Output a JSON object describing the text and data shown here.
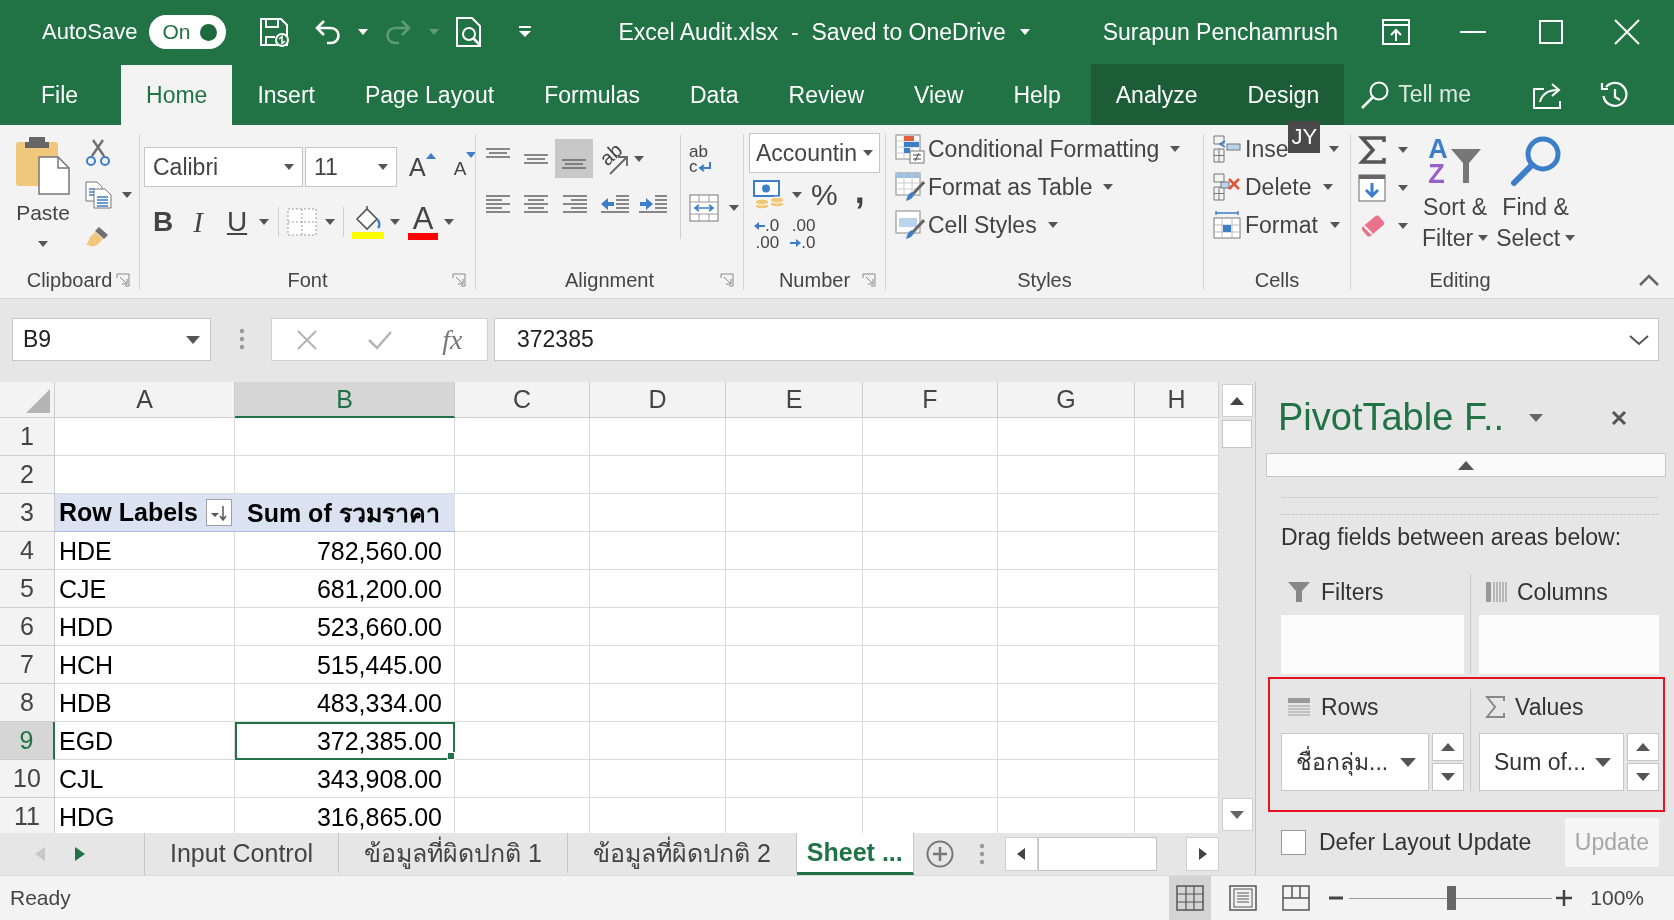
{
  "title_bar": {
    "autosave": {
      "label": "AutoSave",
      "toggle_text": "On",
      "on": true
    },
    "quick_access": [
      {
        "kind": "save",
        "disabled": false
      },
      {
        "kind": "undo",
        "disabled": false
      },
      {
        "kind": "redo",
        "disabled": true
      },
      {
        "kind": "preview",
        "disabled": false
      },
      {
        "kind": "customize",
        "disabled": false
      }
    ],
    "document_title": "Excel Audit.xlsx  -  Saved to OneDrive",
    "user_name": "Surapun Penchamrush"
  },
  "ribbon_tabs": {
    "tabs": [
      {
        "label": "File",
        "selected": false,
        "contextual": false
      },
      {
        "label": "Home",
        "selected": true,
        "contextual": false
      },
      {
        "label": "Insert",
        "selected": false,
        "contextual": false
      },
      {
        "label": "Page Layout",
        "selected": false,
        "contextual": false
      },
      {
        "label": "Formulas",
        "selected": false,
        "contextual": false
      },
      {
        "label": "Data",
        "selected": false,
        "contextual": false
      },
      {
        "label": "Review",
        "selected": false,
        "contextual": false
      },
      {
        "label": "View",
        "selected": false,
        "contextual": false
      },
      {
        "label": "Help",
        "selected": false,
        "contextual": false
      },
      {
        "label": "Analyze",
        "selected": false,
        "contextual": true
      },
      {
        "label": "Design",
        "selected": false,
        "contextual": true
      }
    ],
    "tell_me": {
      "placeholder": "Tell me"
    }
  },
  "ribbon": {
    "clipboard": {
      "label": "Clipboard",
      "paste": "Paste"
    },
    "font": {
      "label": "Font",
      "font_name": "Calibri",
      "font_size": "11",
      "grow_font": "A",
      "shrink_font": "A",
      "bold": "B",
      "italic": "I",
      "underline": "U",
      "font_color": "A"
    },
    "alignment": {
      "label": "Alignment",
      "vertical": [
        {
          "kind": "top",
          "selected": false
        },
        {
          "kind": "middle",
          "selected": false
        },
        {
          "kind": "bottom",
          "selected": true
        }
      ],
      "orientation": "ab",
      "wrap_text": [
        "ab",
        "c"
      ]
    },
    "number": {
      "label": "Number",
      "format": "Accountin",
      "percent": "%",
      "comma": ",",
      "increase_decimal": [
        ".0",
        ".00"
      ],
      "decrease_decimal": [
        ".00",
        ".0"
      ]
    },
    "styles": {
      "label": "Styles",
      "commands": [
        "Conditional Formatting",
        "Format as Table",
        "Cell Styles"
      ]
    },
    "cells": {
      "label": "Cells",
      "commands": [
        "Inse",
        "Delete",
        "Format"
      ],
      "keytip": "JY"
    },
    "editing": {
      "label": "Editing",
      "sort_letters": [
        "A",
        "Z"
      ],
      "sort_filter": [
        "Sort &",
        "Filter"
      ],
      "find_select": [
        "Find &",
        "Select"
      ]
    }
  },
  "formula_bar": {
    "name_box": "B9",
    "insert_function": "fx",
    "formula": "372385"
  },
  "sheet": {
    "columns": [
      {
        "label": "A",
        "selected": false
      },
      {
        "label": "B",
        "selected": true
      },
      {
        "label": "C",
        "selected": false
      },
      {
        "label": "D",
        "selected": false
      },
      {
        "label": "E",
        "selected": false
      },
      {
        "label": "F",
        "selected": false
      },
      {
        "label": "G",
        "selected": false
      },
      {
        "label": "H",
        "selected": false
      }
    ],
    "rows": [
      {
        "header": "1",
        "selected": false,
        "kind": "empty"
      },
      {
        "header": "2",
        "selected": false,
        "kind": "empty"
      },
      {
        "header": "3",
        "selected": false,
        "kind": "pivot_header",
        "cells": [
          "Row Labels",
          "Sum of รวมราคา"
        ]
      },
      {
        "header": "4",
        "selected": false,
        "kind": "data",
        "cells": [
          "HDE",
          "782,560.00"
        ]
      },
      {
        "header": "5",
        "selected": false,
        "kind": "data",
        "cells": [
          "CJE",
          "681,200.00"
        ]
      },
      {
        "header": "6",
        "selected": false,
        "kind": "data",
        "cells": [
          "HDD",
          "523,660.00"
        ]
      },
      {
        "header": "7",
        "selected": false,
        "kind": "data",
        "cells": [
          "HCH",
          "515,445.00"
        ]
      },
      {
        "header": "8",
        "selected": false,
        "kind": "data",
        "cells": [
          "HDB",
          "483,334.00"
        ]
      },
      {
        "header": "9",
        "selected": true,
        "kind": "data",
        "cells": [
          "EGD",
          "372,385.00"
        ]
      },
      {
        "header": "10",
        "selected": false,
        "kind": "data",
        "cells": [
          "CJL",
          "343,908.00"
        ]
      },
      {
        "header": "11",
        "selected": false,
        "kind": "data",
        "cells": [
          "HDG",
          "316,865.00"
        ]
      }
    ]
  },
  "sheet_tabs": {
    "nav": [
      {
        "kind": "previous",
        "disabled": true
      },
      {
        "kind": "next",
        "disabled": false
      }
    ],
    "tabs": [
      {
        "label": "Input Control",
        "selected": false
      },
      {
        "label": "ข้อมูลที่ผิดปกติ 1",
        "selected": false
      },
      {
        "label": "ข้อมูลที่ผิดปกติ 2",
        "selected": false
      },
      {
        "label": "Sheet ...",
        "selected": true
      }
    ]
  },
  "pivot_pane": {
    "title": "PivotTable F..",
    "instructions": "Drag fields between areas below:",
    "area_rows": [
      {
        "highlighted": false,
        "areas": [
          {
            "kind": "filters",
            "label": "Filters"
          },
          {
            "kind": "columns",
            "label": "Columns"
          }
        ]
      },
      {
        "highlighted": true,
        "areas": [
          {
            "kind": "rows",
            "label": "Rows",
            "field": "ชื่อกลุ่ม..."
          },
          {
            "kind": "values",
            "label": "Values",
            "field": "Sum of..."
          }
        ]
      }
    ],
    "defer_update": {
      "label": "Defer Layout Update",
      "checked": false
    },
    "update_button": {
      "label": "Update",
      "disabled": true
    }
  },
  "status_bar": {
    "status": "Ready",
    "views": [
      {
        "kind": "normal",
        "selected": true
      },
      {
        "kind": "page_layout",
        "selected": false
      },
      {
        "kind": "page_break",
        "selected": false
      }
    ],
    "zoom": {
      "level": 0.5,
      "reading": "100%"
    }
  }
}
